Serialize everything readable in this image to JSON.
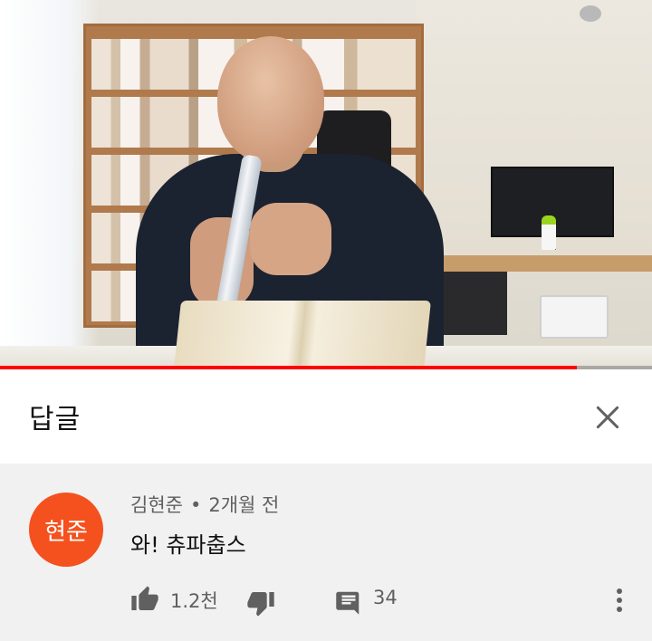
{
  "video": {
    "progress": 0.885,
    "progress_color": "#ff0000"
  },
  "panel": {
    "title": "답글"
  },
  "comment": {
    "avatar_text": "현준",
    "avatar_color": "#f4511e",
    "author": "김현준",
    "separator": "•",
    "time": "2개월 전",
    "text": "와! 츄파춥스",
    "like_count": "1.2천",
    "reply_count": "34"
  },
  "icons": {
    "close": "close-icon",
    "like": "thumbs-up-icon",
    "dislike": "thumbs-down-icon",
    "reply": "comment-icon",
    "more": "more-vert-icon"
  }
}
